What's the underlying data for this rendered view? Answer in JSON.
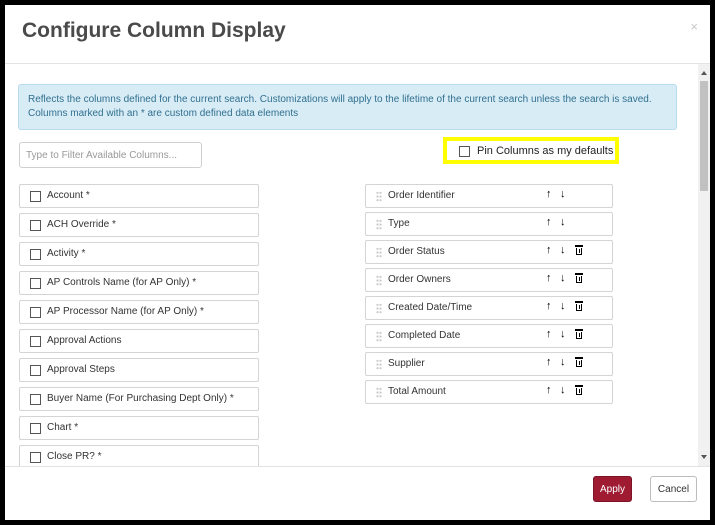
{
  "dialog": {
    "title": "Configure Column Display",
    "close_label": "×"
  },
  "info_text": "Reflects the columns defined for the current search. Customizations will apply to the lifetime of the current search unless the search is saved. Columns marked with an * are custom defined data elements",
  "filter": {
    "placeholder": "Type to Filter Available Columns...",
    "value": ""
  },
  "pin_defaults": {
    "label": "Pin Columns as my defaults",
    "checked": false
  },
  "available_columns": [
    {
      "label": "Account *"
    },
    {
      "label": "ACH Override *"
    },
    {
      "label": "Activity *"
    },
    {
      "label": "AP Controls Name (for AP Only) *"
    },
    {
      "label": "AP Processor Name (for AP Only) *"
    },
    {
      "label": "Approval Actions"
    },
    {
      "label": "Approval Steps"
    },
    {
      "label": "Buyer Name (For Purchasing Dept Only) *"
    },
    {
      "label": "Chart *"
    },
    {
      "label": "Close PR? *"
    }
  ],
  "selected_columns": [
    {
      "label": "Order Identifier",
      "deletable": false
    },
    {
      "label": "Type",
      "deletable": false
    },
    {
      "label": "Order Status",
      "deletable": true
    },
    {
      "label": "Order Owners",
      "deletable": true
    },
    {
      "label": "Created Date/Time",
      "deletable": true
    },
    {
      "label": "Completed Date",
      "deletable": true
    },
    {
      "label": "Supplier",
      "deletable": true
    },
    {
      "label": "Total Amount",
      "deletable": true
    }
  ],
  "controls": {
    "up_icon": "arrow-up-icon",
    "down_icon": "arrow-down-icon",
    "delete_icon": "trash-icon"
  },
  "footer": {
    "apply_label": "Apply",
    "cancel_label": "Cancel"
  },
  "colors": {
    "primary_button": "#9e1b32",
    "info_background": "#d8ecf6",
    "highlight": "#ffff00"
  }
}
